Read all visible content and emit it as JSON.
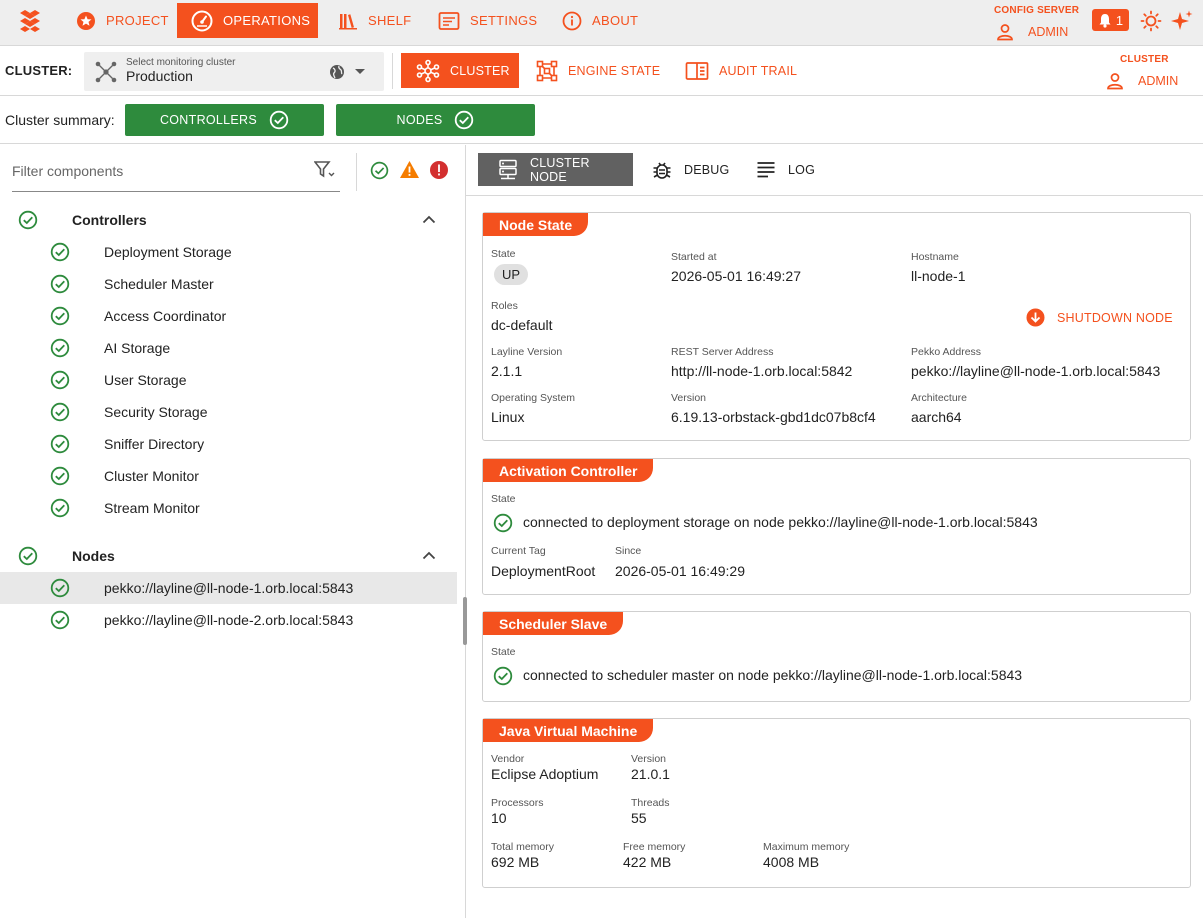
{
  "colors": {
    "accent": "#f4511e",
    "ok": "#2e8b3d",
    "warn": "#f57c00",
    "error": "#d32f2f",
    "active_tab": "#616161"
  },
  "nav": {
    "items": [
      {
        "label": "PROJECT",
        "icon": "star-icon"
      },
      {
        "label": "OPERATIONS",
        "icon": "speedometer-icon",
        "active": true
      },
      {
        "label": "SHELF",
        "icon": "books-icon"
      },
      {
        "label": "SETTINGS",
        "icon": "settings-panel-icon"
      },
      {
        "label": "ABOUT",
        "icon": "info-icon"
      }
    ],
    "config_server_label": "CONFIG SERVER",
    "config_server_user": "ADMIN",
    "notification_count": "1"
  },
  "cluster": {
    "label": "CLUSTER:",
    "select_caption": "Select monitoring cluster",
    "select_value": "Production",
    "tabs": [
      {
        "label": "CLUSTER",
        "icon": "cluster-icon",
        "active": true
      },
      {
        "label": "ENGINE STATE",
        "icon": "engine-state-icon"
      },
      {
        "label": "AUDIT TRAIL",
        "icon": "audit-book-icon"
      }
    ],
    "right_label": "CLUSTER",
    "right_user": "ADMIN"
  },
  "summary": {
    "label": "Cluster summary:",
    "controllers": "CONTROLLERS",
    "nodes": "NODES"
  },
  "filter": {
    "placeholder": "Filter components"
  },
  "tree": {
    "controllers_label": "Controllers",
    "controllers": [
      "Deployment Storage",
      "Scheduler Master",
      "Access Coordinator",
      "AI Storage",
      "User Storage",
      "Security Storage",
      "Sniffer Directory",
      "Cluster Monitor",
      "Stream Monitor"
    ],
    "nodes_label": "Nodes",
    "nodes": [
      "pekko://layline@ll-node-1.orb.local:5843",
      "pekko://layline@ll-node-2.orb.local:5843"
    ]
  },
  "detail_tabs": [
    {
      "label": "CLUSTER NODE",
      "active": true
    },
    {
      "label": "DEBUG"
    },
    {
      "label": "LOG"
    }
  ],
  "node_state": {
    "title": "Node State",
    "state_label": "State",
    "state": "UP",
    "started_label": "Started at",
    "started": "2026-05-01 16:49:27",
    "hostname_label": "Hostname",
    "hostname": "ll-node-1",
    "roles_label": "Roles",
    "roles": "dc-default",
    "shutdown_label": "SHUTDOWN NODE",
    "version_label": "Layline Version",
    "version": "2.1.1",
    "rest_label": "REST Server Address",
    "rest": "http://ll-node-1.orb.local:5842",
    "pekko_label": "Pekko Address",
    "pekko": "pekko://layline@ll-node-1.orb.local:5843",
    "os_label": "Operating System",
    "os": "Linux",
    "osver_label": "Version",
    "osver": "6.19.13-orbstack-gbd1dc07b8cf4",
    "arch_label": "Architecture",
    "arch": "aarch64"
  },
  "activation": {
    "title": "Activation Controller",
    "state_label": "State",
    "state": "connected to deployment storage on node pekko://layline@ll-node-1.orb.local:5843",
    "tag_label": "Current Tag",
    "tag": "DeploymentRoot",
    "since_label": "Since",
    "since": "2026-05-01 16:49:29"
  },
  "scheduler": {
    "title": "Scheduler Slave",
    "state_label": "State",
    "state": "connected to scheduler master on node pekko://layline@ll-node-1.orb.local:5843"
  },
  "jvm": {
    "title": "Java Virtual Machine",
    "vendor_label": "Vendor",
    "vendor": "Eclipse Adoptium",
    "version_label": "Version",
    "version": "21.0.1",
    "processors_label": "Processors",
    "processors": "10",
    "threads_label": "Threads",
    "threads": "55",
    "total_label": "Total memory",
    "total": "692 MB",
    "free_label": "Free memory",
    "free": "422 MB",
    "max_label": "Maximum memory",
    "max": "4008 MB"
  }
}
